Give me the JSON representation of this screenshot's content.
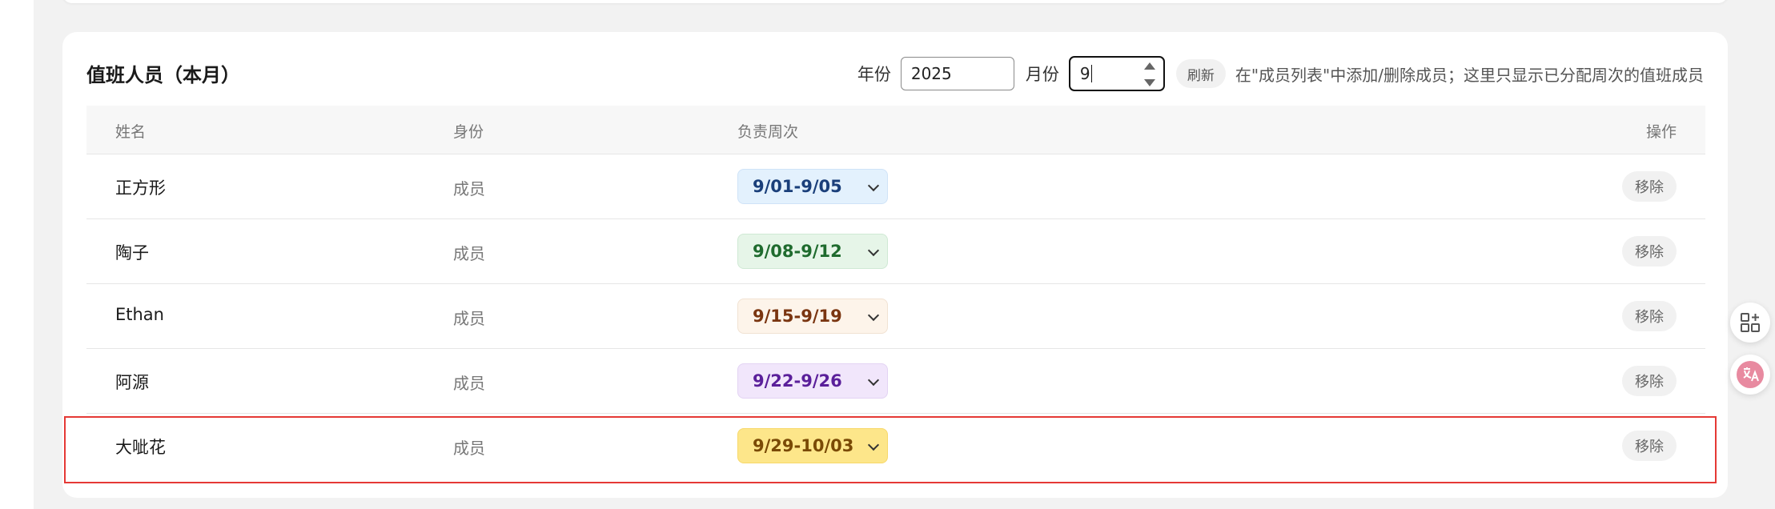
{
  "card": {
    "title": "值班人员（本月）",
    "year_label": "年份",
    "year_value": "2025",
    "month_label": "月份",
    "month_value": "9",
    "refresh_label": "刷新",
    "hint": "在\"成员列表\"中添加/删除成员；这里只显示已分配周次的值班成员"
  },
  "table": {
    "headers": {
      "name": "姓名",
      "role": "身份",
      "week": "负责周次",
      "action": "操作"
    },
    "rows": [
      {
        "name": "正方形",
        "role": "成员",
        "week": "9/01-9/05",
        "action": "移除",
        "bg": "#e3f1fd",
        "fg": "#1a3f7a",
        "border": "#cfe3f7"
      },
      {
        "name": "陶子",
        "role": "成员",
        "week": "9/08-9/12",
        "action": "移除",
        "bg": "#e6f5e8",
        "fg": "#1f6b2e",
        "border": "#cfe9d4"
      },
      {
        "name": "Ethan",
        "role": "成员",
        "week": "9/15-9/19",
        "action": "移除",
        "bg": "#fdf4ea",
        "fg": "#7a3510",
        "border": "#f1e2d2"
      },
      {
        "name": "阿源",
        "role": "成员",
        "week": "9/22-9/26",
        "action": "移除",
        "bg": "#f1e6fb",
        "fg": "#5a1f9a",
        "border": "#e3d3f3"
      },
      {
        "name": "大呲花",
        "role": "成员",
        "week": "9/29-10/03",
        "action": "移除",
        "bg": "#fde68a",
        "fg": "#7a4a06",
        "border": "#f7d86a"
      }
    ]
  },
  "colors": {
    "highlight": "#e53935",
    "translate_icon": "#e88aa0"
  },
  "icons": {
    "apps": "apps-add-icon",
    "translate": "translate-icon"
  }
}
